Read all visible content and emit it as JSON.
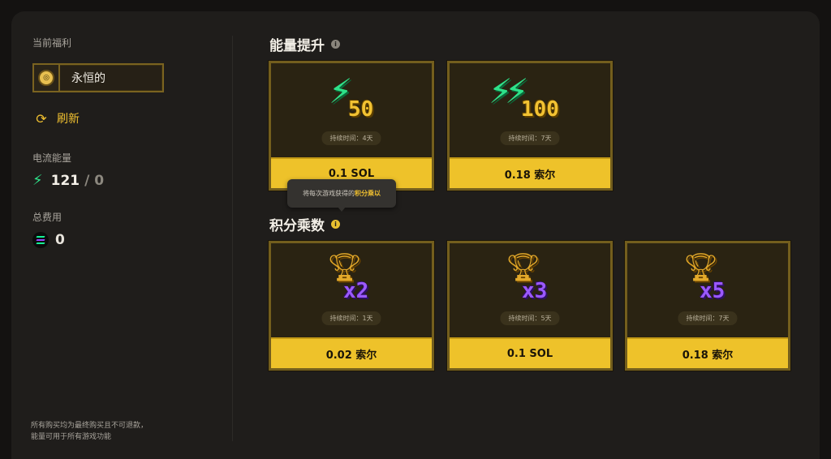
{
  "sidebar": {
    "current_perk_label": "当前福利",
    "current_perk_value": "永恒的",
    "refresh_label": "刷新",
    "energy_label": "电流能量",
    "energy_current": "121",
    "energy_separator": "/",
    "energy_max": "0",
    "total_fee_label": "总费用",
    "total_fee_value": "0",
    "footer_line1": "所有购买均为最终购买且不可退款，",
    "footer_line2": "能量可用于所有游戏功能"
  },
  "energy_boost": {
    "title": "能量提升",
    "cards": [
      {
        "amount": "50",
        "duration": "持续时间：4天",
        "price": "0.1 SOL"
      },
      {
        "amount": "100",
        "duration": "持续时间：7天",
        "price": "0.18 索尔"
      }
    ]
  },
  "tooltip": {
    "prefix": "将每次游戏获得的",
    "highlight": "积分乘以"
  },
  "multiplier": {
    "title": "积分乘数",
    "cards": [
      {
        "multiplier": "x2",
        "duration": "持续时间：1天",
        "price": "0.02 索尔"
      },
      {
        "multiplier": "x3",
        "duration": "持续时间：5天",
        "price": "0.1 SOL"
      },
      {
        "multiplier": "x5",
        "duration": "持续时间：7天",
        "price": "0.18 索尔"
      }
    ]
  },
  "colors": {
    "accent_yellow": "#eec22a",
    "energy_green": "#2ee28a",
    "multiplier_purple": "#9b59ff",
    "card_border": "#735e1d"
  },
  "icons": {
    "perk": "coin-icon",
    "refresh": "refresh-icon",
    "energy": "lightning-bolt-icon",
    "fee": "solana-icon",
    "info": "info-icon",
    "trophy": "trophy-icon"
  }
}
